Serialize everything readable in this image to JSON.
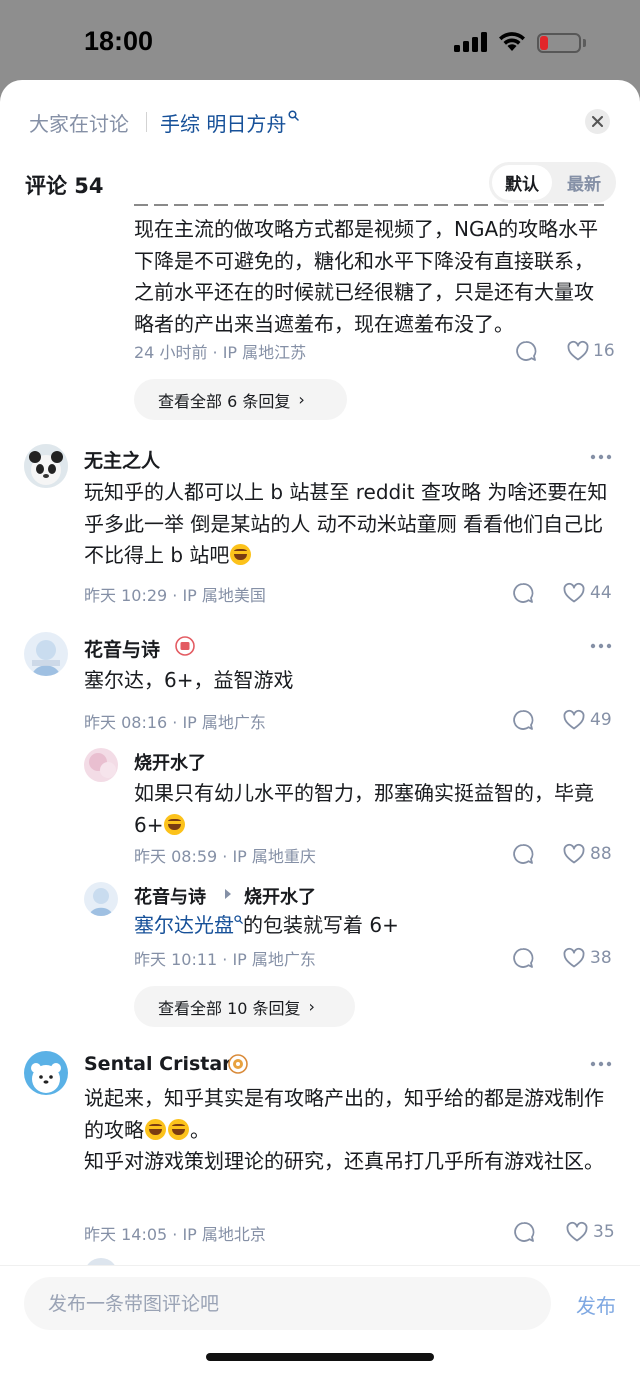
{
  "status_bar": {
    "time": "18:00"
  },
  "topic_bar": {
    "prefix": "大家在讨论",
    "topic": "手综 明日方舟"
  },
  "comments_header": {
    "title": "评论 54",
    "sort_default": "默认",
    "sort_newest": "最新"
  },
  "comments": [
    {
      "text": "现在主流的做攻略方式都是视频了，NGA的攻略水平下降是不可避免的，糖化和水平下降没有直接联系，之前水平还在的时候就已经很糖了，只是还有大量攻略者的产出来当遮羞布，现在遮羞布没了。",
      "meta": "24 小时前 · IP 属地江苏",
      "likes": "16",
      "view_all": "查看全部 6 条回复"
    },
    {
      "author": "无主之人",
      "text": "玩知乎的人都可以上 b 站甚至 reddit 查攻略 为啥还要在知乎多此一举 倒是某站的人 动不动米站童厕 看看他们自己比不比得上 b 站吧",
      "meta": "昨天 10:29 · IP 属地美国",
      "likes": "44"
    },
    {
      "author": "花音与诗",
      "text": "塞尔达，6+，益智游戏",
      "meta": "昨天 08:16 · IP 属地广东",
      "likes": "49",
      "replies": [
        {
          "author": "烧开水了",
          "text": "如果只有幼儿水平的智力，那塞确实挺益智的，毕竟6+",
          "meta": "昨天 08:59 · IP 属地重庆",
          "likes": "88"
        },
        {
          "author": "花音与诗",
          "reply_to": "烧开水了",
          "link_text": "塞尔达光盘",
          "text": "的包装就写着 6+",
          "meta": "昨天 10:11 · IP 属地广东",
          "likes": "38"
        }
      ],
      "view_all": "查看全部 10 条回复"
    },
    {
      "author": "Sental Cristar",
      "text_line1": "说起来，知乎其实是有攻略产出的，知乎给的都是游戏制作的攻略",
      "text_line2": "知乎对游戏策划理论的研究，还真吊打几乎所有游戏社区。",
      "meta": "昨天 14:05 · IP 属地北京",
      "likes": "35"
    }
  ],
  "bottom_bar": {
    "placeholder": "发布一条带图评论吧",
    "publish_label": "发布"
  },
  "colors": {
    "accent_link": "#175199",
    "meta_gray": "#8590a6",
    "publish_disabled": "#7fa8e2"
  },
  "icons": [
    "signal-icon",
    "wifi-icon",
    "battery-icon",
    "search-icon",
    "close-icon",
    "reply-icon",
    "heart-icon",
    "more-icon",
    "chevron-right-icon",
    "laughing-emoji-icon"
  ]
}
